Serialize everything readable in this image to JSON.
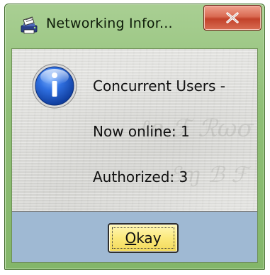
{
  "window": {
    "title": "Networking Infor...",
    "app_icon": "printer-network-icon",
    "close_icon": "close-x-icon"
  },
  "message": {
    "icon": "info-icon",
    "line1": "Concurrent Users -",
    "line2": "Now online: 1",
    "line3": "Authorized: 3"
  },
  "buttons": {
    "okay_mnemonic": "O",
    "okay_rest": "kay"
  },
  "colors": {
    "frame": "#8fbf76",
    "close_button": "#c2422a",
    "button_bar": "#9fb9d3",
    "okay_button": "#fbe97c",
    "info_icon": "#1f5fc8"
  }
}
